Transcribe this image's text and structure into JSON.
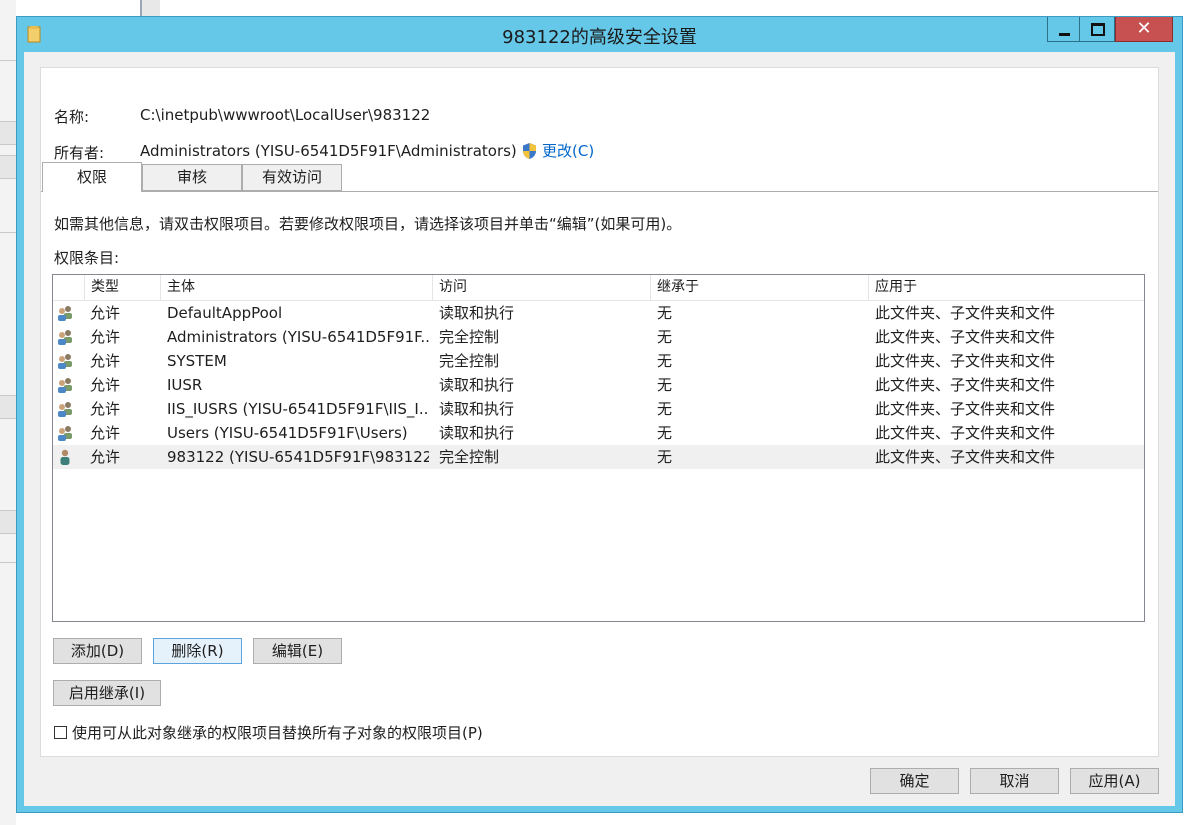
{
  "window": {
    "title": "983122的高级安全设置",
    "colors": {
      "title_bar": "#66c8e8",
      "close_button": "#c75050",
      "link": "#0066cc"
    }
  },
  "icons": {
    "title": "folder-icon",
    "change_owner": "uac-shield-icon",
    "group": "user-group-icon",
    "user": "user-icon"
  },
  "name_field": {
    "label": "名称:",
    "value": "C:\\inetpub\\wwwroot\\LocalUser\\983122"
  },
  "owner_field": {
    "label": "所有者:",
    "value": "Administrators (YISU-6541D5F91F\\Administrators)",
    "change_link": "更改(C)"
  },
  "tabs": [
    {
      "label": "权限",
      "active": true
    },
    {
      "label": "审核",
      "active": false
    },
    {
      "label": "有效访问",
      "active": false
    }
  ],
  "info_text": "如需其他信息，请双击权限项目。若要修改权限项目，请选择该项目并单击“编辑”(如果可用)。",
  "entries_label": "权限条目:",
  "table": {
    "columns": [
      "类型",
      "主体",
      "访问",
      "继承于",
      "应用于"
    ],
    "rows": [
      {
        "icon": "user-group-icon",
        "type": "允许",
        "principal": "DefaultAppPool",
        "access": "读取和执行",
        "inherited_from": "无",
        "applies_to": "此文件夹、子文件夹和文件"
      },
      {
        "icon": "user-group-icon",
        "type": "允许",
        "principal": "Administrators (YISU-6541D5F91F...",
        "access": "完全控制",
        "inherited_from": "无",
        "applies_to": "此文件夹、子文件夹和文件"
      },
      {
        "icon": "user-group-icon",
        "type": "允许",
        "principal": "SYSTEM",
        "access": "完全控制",
        "inherited_from": "无",
        "applies_to": "此文件夹、子文件夹和文件"
      },
      {
        "icon": "user-group-icon",
        "type": "允许",
        "principal": "IUSR",
        "access": "读取和执行",
        "inherited_from": "无",
        "applies_to": "此文件夹、子文件夹和文件"
      },
      {
        "icon": "user-group-icon",
        "type": "允许",
        "principal": "IIS_IUSRS (YISU-6541D5F91F\\IIS_I...",
        "access": "读取和执行",
        "inherited_from": "无",
        "applies_to": "此文件夹、子文件夹和文件"
      },
      {
        "icon": "user-group-icon",
        "type": "允许",
        "principal": "Users (YISU-6541D5F91F\\Users)",
        "access": "读取和执行",
        "inherited_from": "无",
        "applies_to": "此文件夹、子文件夹和文件"
      },
      {
        "icon": "user-icon",
        "type": "允许",
        "principal": "983122 (YISU-6541D5F91F\\983122)",
        "access": "完全控制",
        "inherited_from": "无",
        "applies_to": "此文件夹、子文件夹和文件",
        "selected": true
      }
    ]
  },
  "buttons": {
    "add": "添加(D)",
    "remove": "删除(R)",
    "edit": "编辑(E)",
    "enable_inheritance": "启用继承(I)",
    "ok": "确定",
    "cancel": "取消",
    "apply": "应用(A)"
  },
  "replace_checkbox": {
    "label": "使用可从此对象继承的权限项目替换所有子对象的权限项目(P)",
    "checked": false
  }
}
